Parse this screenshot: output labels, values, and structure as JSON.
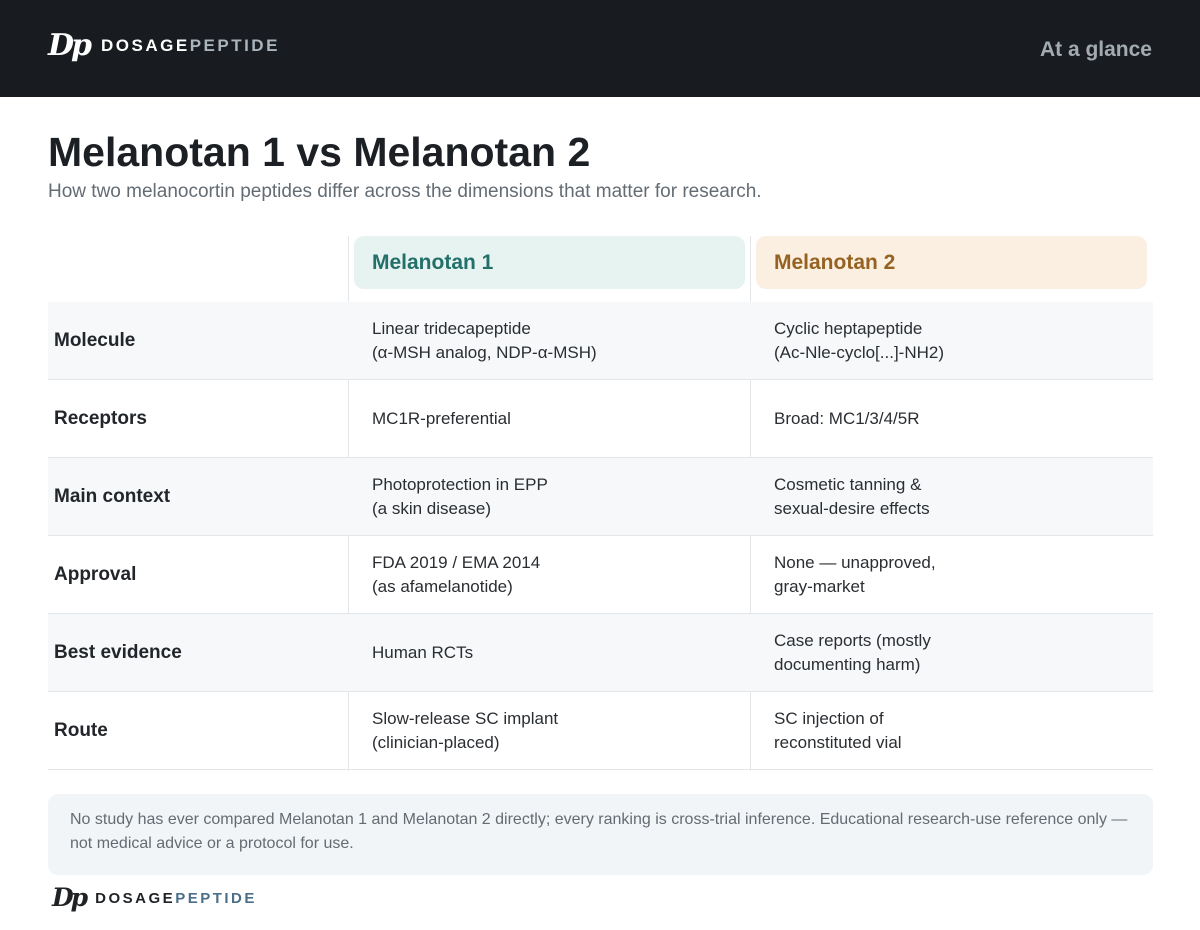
{
  "header": {
    "logo_mark": "Dp",
    "logo_word_1": "DOSAGE",
    "logo_word_2": "PEPTIDE",
    "tagline": "At a glance"
  },
  "page": {
    "title": "Melanotan 1 vs Melanotan 2",
    "subtitle": "How two melanocortin peptides differ across the dimensions that matter for research."
  },
  "table": {
    "columns": [
      "Melanotan 1",
      "Melanotan 2"
    ],
    "rows": [
      {
        "label": "Molecule",
        "mt1": [
          "Linear tridecapeptide",
          "(α-MSH analog, NDP-α-MSH)"
        ],
        "mt2": [
          "Cyclic heptapeptide",
          "(Ac-Nle-cyclo[...]-NH2)"
        ]
      },
      {
        "label": "Receptors",
        "mt1": [
          "MC1R-preferential"
        ],
        "mt2": [
          "Broad: MC1/3/4/5R"
        ]
      },
      {
        "label": "Main context",
        "mt1": [
          "Photoprotection in EPP",
          "(a skin disease)"
        ],
        "mt2": [
          "Cosmetic tanning &",
          "sexual-desire effects"
        ]
      },
      {
        "label": "Approval",
        "mt1": [
          "FDA 2019 / EMA 2014",
          "(as afamelanotide)"
        ],
        "mt2": [
          "None — unapproved,",
          "gray-market"
        ]
      },
      {
        "label": "Best evidence",
        "mt1": [
          "Human RCTs"
        ],
        "mt2": [
          "Case reports (mostly",
          "documenting harm)"
        ]
      },
      {
        "label": "Route",
        "mt1": [
          "Slow-release SC implant",
          "(clinician-placed)"
        ],
        "mt2": [
          "SC injection of",
          "reconstituted vial"
        ]
      }
    ]
  },
  "note": {
    "text": "No study has ever compared Melanotan 1 and Melanotan 2 directly; every ranking is cross-trial inference. Educational research-use reference only — not medical advice or a protocol for use."
  },
  "footer": {
    "logo_mark": "Dp",
    "logo_word_1": "DOSAGE",
    "logo_word_2": "PEPTIDE"
  },
  "colors": {
    "header_bg": "#181c20",
    "mt1_accent": "#23706a",
    "mt1_bg": "#e6f3f0",
    "mt2_accent": "#966221",
    "mt2_bg": "#faefe1"
  }
}
